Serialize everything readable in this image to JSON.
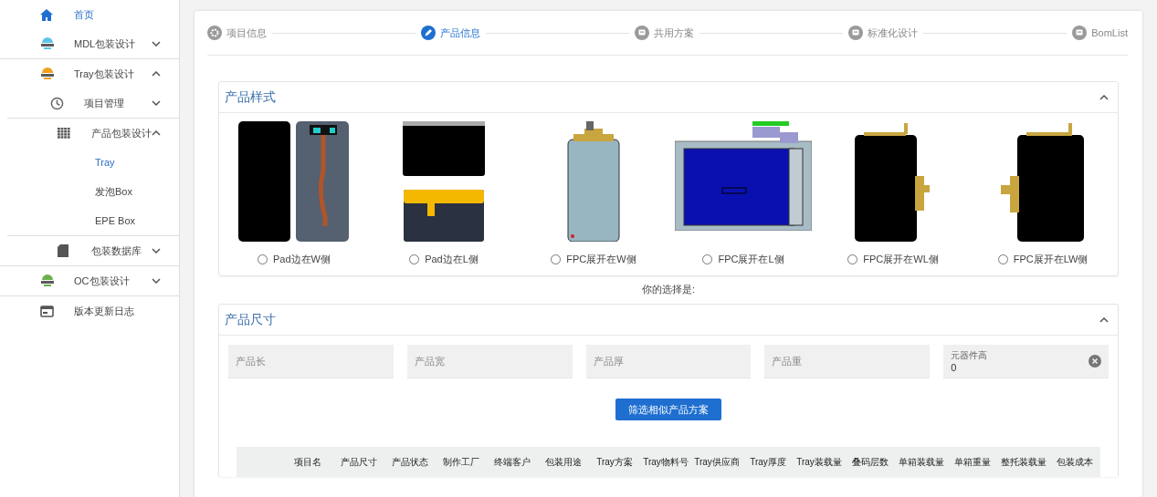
{
  "sidebar": {
    "items": [
      {
        "label": "首页",
        "selected": true
      },
      {
        "label": "MDL包装设计",
        "selected": false,
        "expanded": false
      },
      {
        "label": "Tray包装设计",
        "selected": false,
        "expanded": true,
        "children": [
          {
            "label": "项目管理",
            "selected": false,
            "expanded": false
          },
          {
            "label": "产品包装设计",
            "selected": false,
            "expanded": true,
            "children": [
              {
                "label": "Tray",
                "selected": true
              },
              {
                "label": "发泡Box",
                "selected": false
              },
              {
                "label": "EPE Box",
                "selected": false
              }
            ]
          },
          {
            "label": "包装数据库",
            "selected": false,
            "expanded": false
          }
        ]
      },
      {
        "label": "OC包装设计",
        "selected": false,
        "expanded": false
      },
      {
        "label": "版本更新日志",
        "selected": false
      }
    ]
  },
  "stepper": {
    "steps": [
      {
        "label": "项目信息",
        "selected": false
      },
      {
        "label": "产品信息",
        "selected": true
      },
      {
        "label": "共用方案",
        "selected": false
      },
      {
        "label": "标准化设计",
        "selected": false
      },
      {
        "label": "BomList",
        "selected": false
      }
    ]
  },
  "product_style": {
    "title": "产品样式",
    "expanded": true,
    "options": [
      {
        "label": "Pad边在W侧",
        "kind": "pad-w",
        "selected": false
      },
      {
        "label": "Pad边在L侧",
        "kind": "pad-l",
        "selected": false
      },
      {
        "label": "FPC展开在W侧",
        "kind": "fpc-w",
        "selected": false
      },
      {
        "label": "FPC展开在L侧",
        "kind": "fpc-l",
        "selected": false
      },
      {
        "label": "FPC展开在WL侧",
        "kind": "fpc-wl",
        "selected": false
      },
      {
        "label": "FPC展开在LW侧",
        "kind": "fpc-lw",
        "selected": false
      }
    ]
  },
  "choice_label": "你的选择是:",
  "product_size": {
    "title": "产品尺寸",
    "expanded": true,
    "fields": [
      {
        "placeholder": "产品长"
      },
      {
        "placeholder": "产品宽"
      },
      {
        "placeholder": "产品厚"
      },
      {
        "placeholder": "产品重"
      },
      {
        "label": "元器件高",
        "value": "0",
        "clearable": true
      }
    ],
    "button": "筛选相似产品方案"
  },
  "table": {
    "columns": [
      "项目名",
      "产品尺寸",
      "产品状态",
      "制作工厂",
      "终端客户",
      "包装用途",
      "Tray方案",
      "Tray物料号",
      "Tray供应商",
      "Tray厚度",
      "Tray装载量",
      "叠码层数",
      "单箱装载量",
      "单箱重量",
      "整托装载量",
      "包装成本"
    ]
  }
}
